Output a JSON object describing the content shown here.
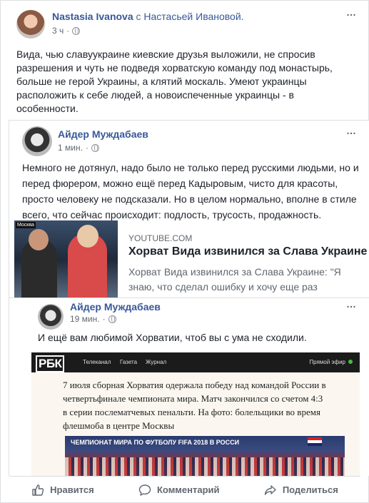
{
  "post": {
    "author": "Nastasia Ivanova",
    "with_word": "с",
    "with_person": "Настасьей Ивановой.",
    "time": "3 ч",
    "more_icon": "…",
    "text": "Вида, чью славуукраине киевские друзья выложили, не спросив\nразрешения и чуть не подведя хорватскую команду под монастырь,\nбольше не герой Украины, а клятий москаль. Умеют украинцы\nрасположить к себе людей, а новоиспеченные украинцы - в\nособенности."
  },
  "shared1": {
    "author": "Айдер Муждабаев",
    "time": "1 мин.",
    "text": "Немного не дотянул, надо было не только перед русскими людьми, но и\nперед фюрером, можно ещё перед Кадыровым, чисто для красоты,\nпросто человеку не подсказали. Но в целом нормально, вполне в стиле\nвсего, что сейчас происходит: подлость, трусость, продажность.",
    "link": {
      "domain": "YOUTUBE.COM",
      "title": "Хорват Вида извинился за Слава Украине",
      "description": "Хорват Вида извинился за Слава Украине: \"Я\nзнаю, что сделал ошибку и хочу еще раз\nизвиниться перед русскими людьми» — сказал",
      "thumb_tag": "Москва"
    }
  },
  "shared2": {
    "author": "Айдер Муждабаев",
    "time": "19 мин.",
    "text": "И ещё вам любимой Хорватии, чтоб вы с ума не сходили.",
    "rbk": {
      "logo": "РБК",
      "nav": [
        "Телеканал",
        "Газета",
        "Журнал"
      ],
      "live": "Прямой эфир",
      "article": "7 июля сборная Хорватия одержала победу над командой России в\nчетвертьфинале чемпионата мира. Матч закончился со счетом 4:3\nв серии послематчевых пенальти. На фото: болельщики во время\nфлешмоба в центре Москвы",
      "photo_caption": "ЧЕМПИОНАТ МИРА ПО ФУТБОЛУ FIFA 2018 В РОССИ"
    }
  },
  "actions": {
    "like": "Нравится",
    "comment": "Комментарий",
    "share": "Поделиться"
  }
}
